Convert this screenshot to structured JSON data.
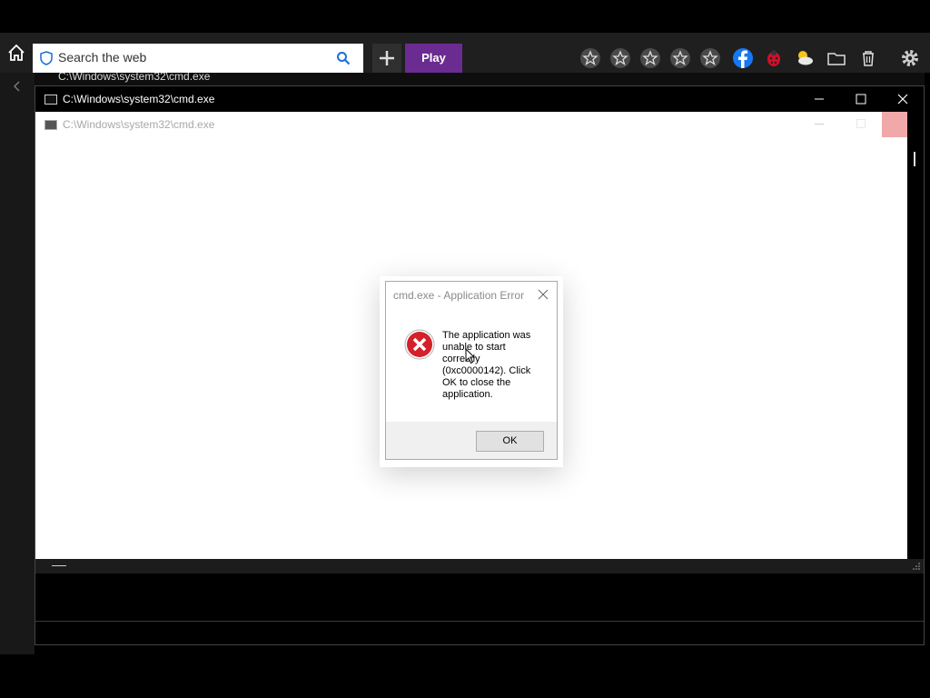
{
  "toolbar": {
    "search_placeholder": "Search the web",
    "play_label": "Play",
    "accent_play": "#6b2c91",
    "icons": [
      "home-icon",
      "shield-icon",
      "search-icon",
      "plus-icon",
      "star-icon",
      "star-icon",
      "star-icon",
      "star-icon",
      "star-icon",
      "facebook-icon",
      "ladybug-icon",
      "weather-icon",
      "folder-icon",
      "trash-icon",
      "gear-icon"
    ]
  },
  "background_window": {
    "title": "C:\\Windows\\system32\\cmd.exe"
  },
  "cmd_window": {
    "title": "C:\\Windows\\system32\\cmd.exe",
    "minimize": "—",
    "maximize": "☐",
    "close": "✕"
  },
  "inner_window": {
    "title": "C:\\Windows\\system32\\cmd.exe"
  },
  "dialog": {
    "title": "cmd.exe - Application Error",
    "message": "The application was unable to start correctly (0xc0000142). Click OK to close the application.",
    "ok_label": "OK",
    "icon": "error-icon"
  }
}
